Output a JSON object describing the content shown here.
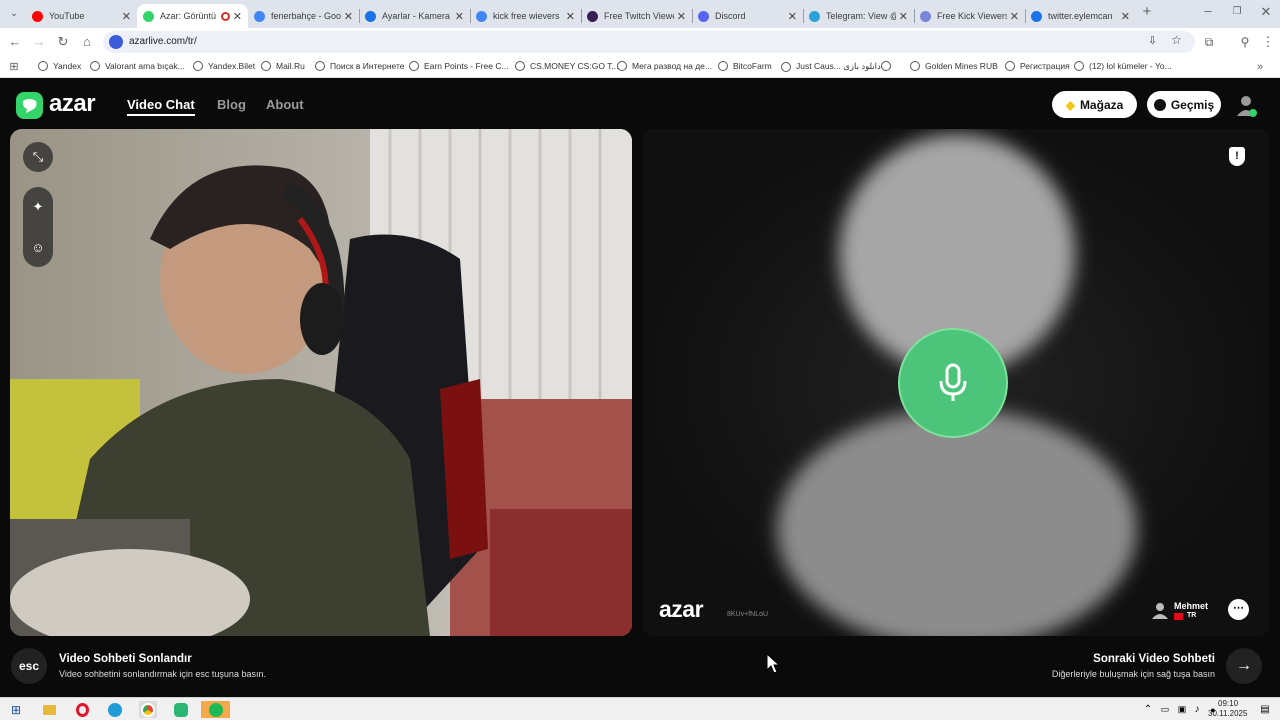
{
  "browser": {
    "tabs": [
      {
        "label": "YouTube",
        "color": "#ff0000",
        "active": false
      },
      {
        "label": "Azar: Görüntü",
        "color": "#35d46a",
        "active": true,
        "recording": true
      },
      {
        "label": "fenerbahçe - Goo",
        "color": "#4285f4",
        "active": false
      },
      {
        "label": "Ayarlar - Kamera",
        "color": "#1a73e8",
        "active": false
      },
      {
        "label": "kick free wievers",
        "color": "#4285f4",
        "active": false
      },
      {
        "label": "Free Twitch Viewe",
        "color": "#3a1f55",
        "active": false
      },
      {
        "label": "Discord",
        "color": "#5865f2",
        "active": false
      },
      {
        "label": "Telegram: View @",
        "color": "#2aa1da",
        "active": false
      },
      {
        "label": "Free Kick Viewers",
        "color": "#7a84d9",
        "active": false
      },
      {
        "label": "twitter.eylemcan",
        "color": "#1a73e8",
        "active": false
      }
    ],
    "new_tab": "+",
    "url": "azarlive.com/tr/",
    "bookmarks": [
      "Yandex",
      "Valorant ama bıçak...",
      "Yandex.Bilet",
      "Mail.Ru",
      "Поиск в Интернете",
      "Earn Points - Free C...",
      "CS.MONEY CS:GO T...",
      "Мега развод на де...",
      "BitcoFarm",
      "Just Caus... دانلود بازی",
      "",
      "Golden Mines RUB",
      "Регистрация",
      "(12) lol kümeler - Yo..."
    ]
  },
  "azar": {
    "logo": "azar",
    "nav": {
      "video_chat": "Video Chat",
      "blog": "Blog",
      "about": "About"
    },
    "shop_label": "Mağaza",
    "history_label": "Geçmiş",
    "watermark": "azar",
    "watermark_id": "8KUv+fNLoU",
    "partner": {
      "name": "Mehmet",
      "country": "TR"
    },
    "bottom": {
      "esc_key": "esc",
      "end_title": "Video Sohbeti Sonlandır",
      "end_sub": "Video sohbetini sonlandırmak için esc tuşuna basın.",
      "next_title": "Sonraki Video Sohbeti",
      "next_sub": "Diğerleriyle buluşmak için sağ tuşa basın"
    },
    "colors": {
      "brand": "#35d46a",
      "mic": "#4cc47a"
    }
  },
  "taskbar": {
    "time": "09:10",
    "date": "30.11.2025"
  }
}
